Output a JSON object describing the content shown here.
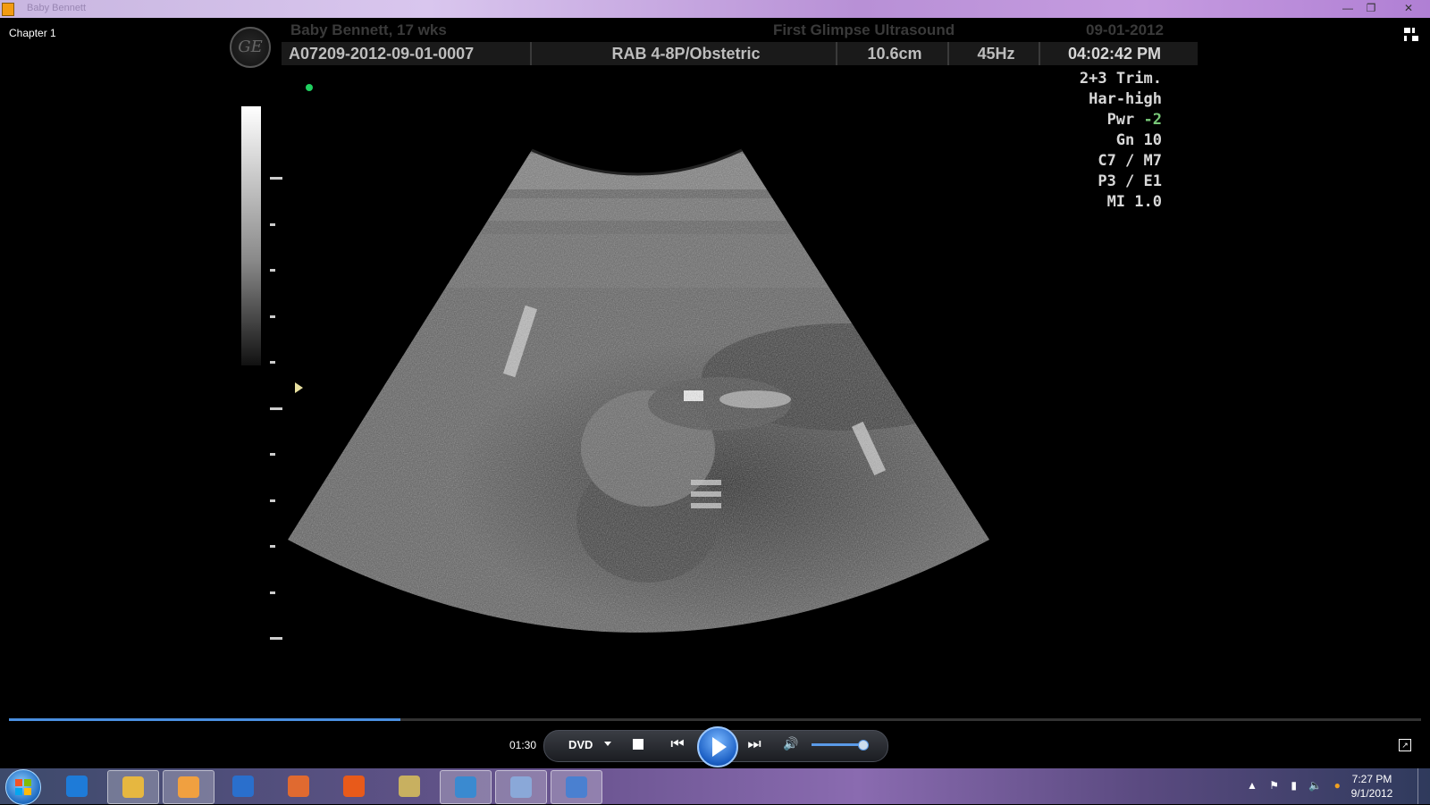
{
  "window": {
    "title": "Baby Bennett",
    "minimize": "—",
    "maximize": "❐",
    "close": "✕"
  },
  "chapter": "Chapter 1",
  "ultrasound": {
    "logo": "GE",
    "patient": "Baby Bennett, 17 wks",
    "studio": "First Glimpse Ultrasound",
    "date": "09-01-2012",
    "id": "A07209-2012-09-01-0007",
    "probe": "RAB 4-8P/Obstetric",
    "depth": "10.6cm",
    "frame_rate": "45Hz",
    "time": "04:02:42 PM",
    "params": [
      {
        "label": "2+3 Trim.",
        "value": ""
      },
      {
        "label": "Har-high",
        "value": ""
      },
      {
        "label": "Pwr",
        "value": "-2"
      },
      {
        "label": "Gn",
        "value": "10"
      },
      {
        "label": "C7 / M7",
        "value": ""
      },
      {
        "label": "P3 / E1",
        "value": ""
      },
      {
        "label": "MI",
        "value": "1.0"
      }
    ]
  },
  "player": {
    "elapsed": "01:30",
    "seek_fraction": 0.277,
    "source": "DVD",
    "volume_fraction": 0.95,
    "icons": {
      "stop": "stop-icon",
      "prev": "skip-previous-icon",
      "play": "play-icon",
      "next": "skip-next-icon",
      "volume": "speaker-icon",
      "fullscreen": "fullscreen-icon",
      "switch": "switch-to-library-icon"
    }
  },
  "taskbar": {
    "apps": [
      {
        "name": "internet-explorer",
        "color": "#1e7bd8",
        "active": false
      },
      {
        "name": "file-explorer",
        "color": "#e6b740",
        "active": true
      },
      {
        "name": "media-player",
        "color": "#f0a040",
        "active": true
      },
      {
        "name": "hp-software",
        "color": "#2a6fcc",
        "active": false
      },
      {
        "name": "photo-app",
        "color": "#e06a30",
        "active": false
      },
      {
        "name": "firefox",
        "color": "#e85a1a",
        "active": false
      },
      {
        "name": "paint",
        "color": "#c8b060",
        "active": false
      },
      {
        "name": "picture-viewer",
        "color": "#3a8ad0",
        "active": true
      },
      {
        "name": "calculator",
        "color": "#8aa8d8",
        "active": true
      },
      {
        "name": "wordpad",
        "color": "#4a80d0",
        "active": true
      }
    ],
    "clock_time": "7:27 PM",
    "clock_date": "9/1/2012"
  }
}
